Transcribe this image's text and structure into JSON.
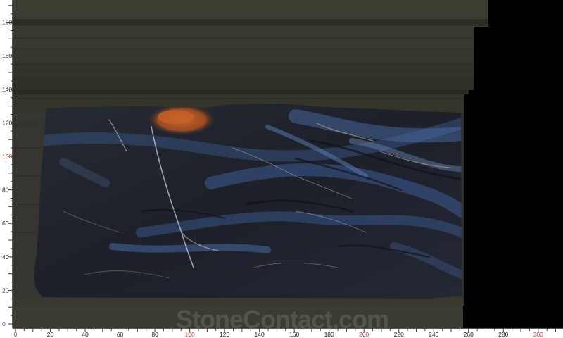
{
  "image": {
    "subject": "marble slab photo on measuring grid",
    "colors": {
      "background": "#000000",
      "backdrop": "#37372d",
      "ruler_bg": "#ffffff",
      "ruler_text_normal": "#222222",
      "ruler_text_highlight": "#c0392b",
      "slab_base": "#20242c",
      "slab_vein_blue": "#3b5a8c",
      "slab_orange": "#b5541f"
    }
  },
  "vertical_ruler": {
    "labels": [
      "180",
      "160",
      "140",
      "120",
      "100",
      "80",
      "60",
      "40",
      "20",
      "0"
    ],
    "highlight": [
      "100",
      "0"
    ]
  },
  "horizontal_ruler": {
    "labels": [
      "0",
      "20",
      "40",
      "60",
      "80",
      "100",
      "120",
      "140",
      "160",
      "180",
      "200",
      "220",
      "240",
      "260",
      "280",
      "300"
    ],
    "highlight": [
      "0",
      "100",
      "200",
      "300"
    ]
  },
  "watermark": {
    "text": "StoneContact.com"
  }
}
